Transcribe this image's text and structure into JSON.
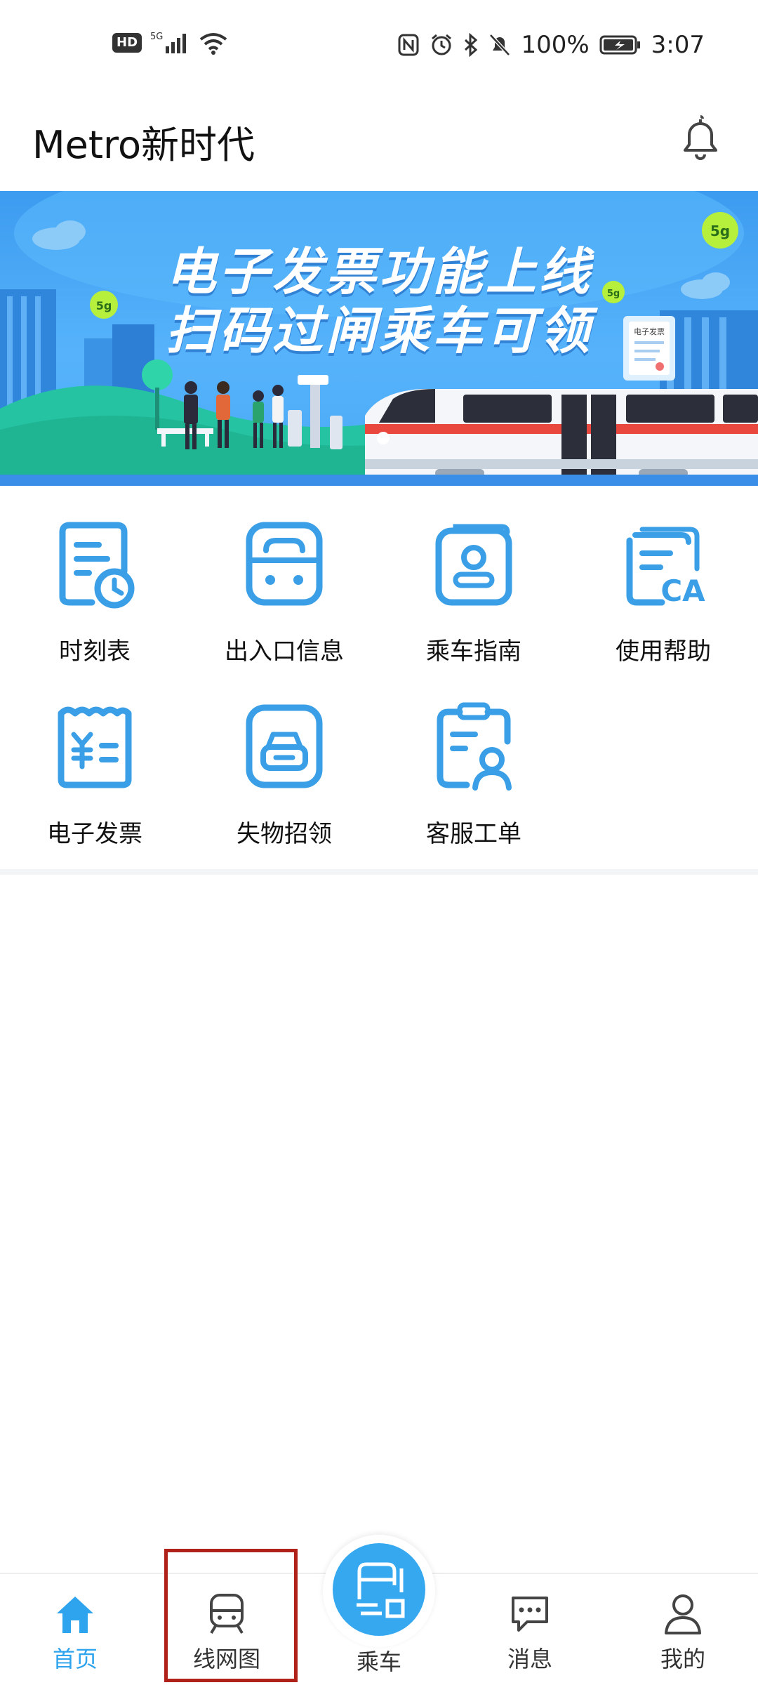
{
  "status_bar": {
    "hd": "HD",
    "network": "5G",
    "battery": "100%",
    "time": "3:07"
  },
  "header": {
    "title": "Metro新时代"
  },
  "banner": {
    "line1": "电子发票功能上线",
    "line2": "扫码过闸乘车可领",
    "badge": "5g",
    "invoice_label": "电子发票"
  },
  "services": [
    {
      "label": "时刻表",
      "icon": "timetable-icon"
    },
    {
      "label": "出入口信息",
      "icon": "entrance-info-icon"
    },
    {
      "label": "乘车指南",
      "icon": "ride-guide-icon"
    },
    {
      "label": "使用帮助",
      "icon": "help-icon"
    },
    {
      "label": "电子发票",
      "icon": "invoice-icon"
    },
    {
      "label": "失物招领",
      "icon": "lost-found-icon"
    },
    {
      "label": "客服工单",
      "icon": "service-ticket-icon"
    }
  ],
  "colors": {
    "accent": "#2ea3ee",
    "icon_blue": "#3a9fe6",
    "highlight": "#b0211a"
  },
  "bottom_nav": {
    "home": "首页",
    "network_map": "线网图",
    "ride": "乘车",
    "messages": "消息",
    "mine": "我的"
  }
}
